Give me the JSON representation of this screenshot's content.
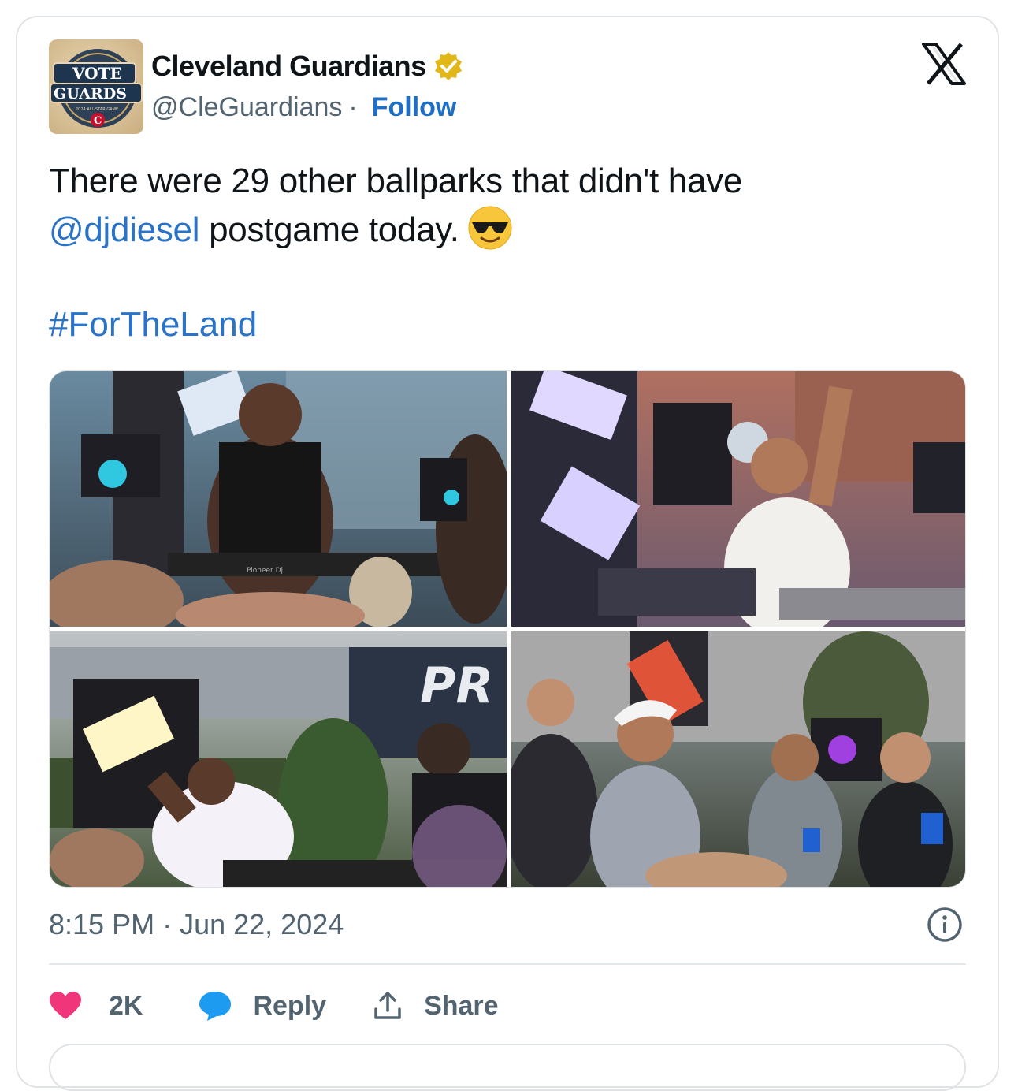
{
  "author": {
    "name": "Cleveland Guardians",
    "handle": "@CleGuardians",
    "separator": "·",
    "follow_label": "Follow",
    "avatar_text": {
      "line1": "VOTE",
      "line2": "GUARDS",
      "line3": "2024 ALL-STAR GAME",
      "letter": "C"
    },
    "verified_badge": "gold-check-badge"
  },
  "tweet": {
    "line1": "There were 29 other ballparks that didn't have",
    "mention": "@djdiesel",
    "line2_rest": " postgame today.",
    "emoji": "smiling-face-with-sunglasses",
    "hashtag": "#ForTheLand"
  },
  "media": {
    "photos": [
      {
        "desc": "dj-in-black-tank-top-at-turntables",
        "overlay_text": "Pioneer Dj"
      },
      {
        "desc": "dj-in-white-shirt-raising-arm",
        "overlay_text": ""
      },
      {
        "desc": "performer-with-microphone-on-stage",
        "overlay_text": "PR"
      },
      {
        "desc": "crowd-of-players-in-caps",
        "overlay_text": ""
      }
    ]
  },
  "meta": {
    "time": "8:15 PM",
    "separator": "·",
    "date": "Jun 22, 2024"
  },
  "actions": {
    "like_count": "2K",
    "reply_label": "Reply",
    "share_label": "Share"
  },
  "colors": {
    "link": "#2a73c7",
    "muted": "#536471",
    "like": "#f0357a",
    "reply": "#1d9bf0",
    "border": "#dfe3e6"
  }
}
